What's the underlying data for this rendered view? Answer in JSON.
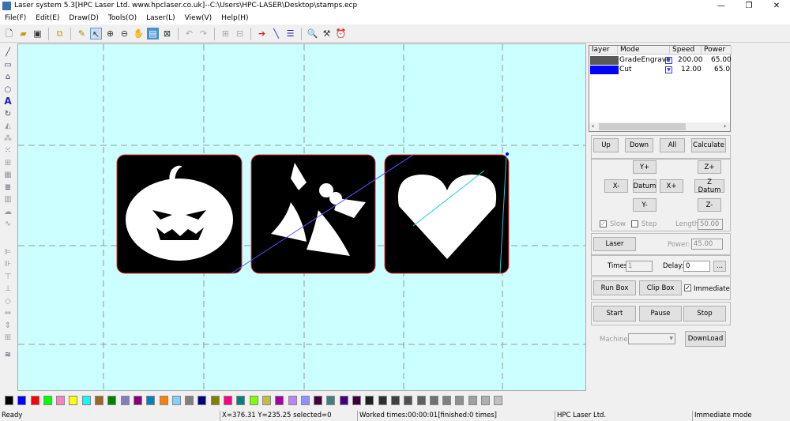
{
  "window": {
    "title": "Laser system 5.3[HPC Laser Ltd. www.hpclaser.co.uk]--C:\\Users\\HPC-LASER\\Desktop\\stamps.ecp",
    "minimize": "—",
    "maximize": "❐",
    "close": "✕"
  },
  "menu": [
    "File(F)",
    "Edit(E)",
    "Draw(D)",
    "Tools(O)",
    "Laser(L)",
    "View(V)",
    "Help(H)"
  ],
  "toolbar_icons": [
    "new-file",
    "open-folder",
    "save",
    "import",
    "clear",
    "select",
    "zoom-in",
    "zoom-out",
    "pan-hand",
    "fit-page",
    "select-all",
    "undo",
    "redo",
    "group",
    "ungroup",
    "direction-arrow",
    "path",
    "node-list",
    "preview",
    "settings",
    "timer"
  ],
  "left_tools": [
    "line",
    "rectangle",
    "polyline",
    "ellipse",
    "text",
    "rotate",
    "mirror",
    "array",
    "nodes",
    "grid",
    "layers",
    "hatch",
    "cut-path",
    "wave",
    "align-left",
    "align-right",
    "align-top",
    "align-bottom",
    "center",
    "distribute",
    "size",
    "merge"
  ],
  "layers": {
    "headers": [
      "layer",
      "Mode",
      "Speed",
      "Power"
    ],
    "rows": [
      {
        "color": "#595959",
        "mode": "GradeEngrave",
        "speed": "200.00",
        "power": "65.00"
      },
      {
        "color": "#0000ff",
        "mode": "Cut",
        "speed": "12.00",
        "power": "65.0"
      }
    ]
  },
  "buttons": {
    "up": "Up",
    "down": "Down",
    "all": "All",
    "calculate": "Calculate",
    "yplus": "Y+",
    "zplus": "Z+",
    "xminus": "X-",
    "datum": "Datum",
    "xplus": "X+",
    "zdatum": "Z Datum",
    "yminus": "Y-",
    "zminus": "Z-",
    "laser": "Laser",
    "runbox": "Run Box",
    "clipbox": "Clip Box",
    "start": "Start",
    "pause": "Pause",
    "stop": "Stop",
    "download": "DownLoad",
    "browse": "..."
  },
  "controls": {
    "slow": "Slow",
    "step": "Step",
    "length_label": "Length:",
    "length": "50.00",
    "power_label": "Power:",
    "power": "45.00",
    "times_label": "Times:",
    "times": "1",
    "delay_label": "Delay:",
    "delay": "0",
    "immediate": "Immediate",
    "machine_label": "Machine:",
    "machine": ""
  },
  "palette": [
    "#000000",
    "#0000ff",
    "#ff0000",
    "#00ff00",
    "#ff80c0",
    "#ffff00",
    "#00ffff",
    "#996633",
    "#008000",
    "#8080c0",
    "#800080",
    "#0080c0",
    "#ff8000",
    "#80d0ff",
    "#808080",
    "#000080",
    "#808000",
    "#ff0080",
    "#008080",
    "#80ff00",
    "#c0c040",
    "#a000a0",
    "#c080ff",
    "#9090ff",
    "#400040",
    "#408080",
    "#400080",
    "#400040",
    "#202020",
    "#303030",
    "#404040",
    "#505050",
    "#606060",
    "#707070",
    "#808080",
    "#909090",
    "#a0a0a0",
    "#b0b0b0",
    "#c0c0c0"
  ],
  "status": {
    "ready": "Ready",
    "coords": "X=376.31 Y=235.25 selected=0",
    "worked": "Worked times:00:00:01[finished:0 times]",
    "company": "HPC Laser Ltd.",
    "mode": "Immediate mode"
  }
}
